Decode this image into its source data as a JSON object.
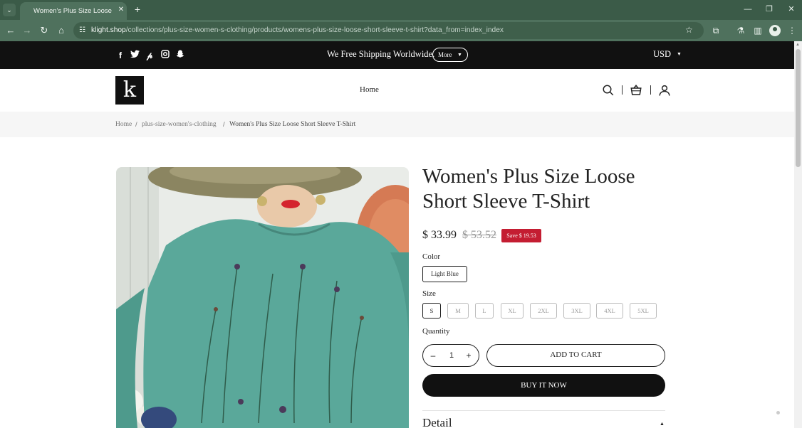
{
  "browser": {
    "tab_title": "Women's Plus Size Loose Short",
    "url_host": "klight.shop",
    "url_path": "/collections/plus-size-women-s-clothing/products/womens-plus-size-loose-short-sleeve-t-shirt?data_from=index_index",
    "icons": [
      "tab-list-icon",
      "close-icon",
      "plus-icon",
      "minimize-icon",
      "restore-icon",
      "window-close-icon",
      "back-icon",
      "forward-icon",
      "reload-icon",
      "home-icon",
      "site-info-icon",
      "bookmark-star-icon",
      "extensions-icon",
      "labs-icon",
      "side-panel-icon",
      "profile-icon",
      "menu-icon"
    ]
  },
  "announcement": {
    "text": "We Free Shipping Worldwide.",
    "more_label": "More",
    "currency": "USD",
    "social_icons": [
      "facebook-icon",
      "twitter-icon",
      "pinterest-icon",
      "instagram-icon",
      "snapchat-icon"
    ]
  },
  "header": {
    "logo_letter": "k",
    "nav_home": "Home",
    "icons": [
      "search-icon",
      "cart-icon",
      "account-icon"
    ]
  },
  "breadcrumb": {
    "home": "Home",
    "collection": "plus-size-women's-clothing",
    "current": "Women's Plus Size Loose Short Sleeve T-Shirt",
    "separator": "/"
  },
  "product": {
    "title": "Women's Plus Size Loose Short Sleeve T-Shirt",
    "price": "$ 33.99",
    "compare_price": "$ 53.52",
    "save_badge": "Save $ 19.53",
    "color_label": "Color",
    "color_selected": "Light Blue",
    "size_label": "Size",
    "sizes": [
      "S",
      "M",
      "L",
      "XL",
      "2XL",
      "3XL",
      "4XL",
      "5XL"
    ],
    "size_selected": "S",
    "quantity_label": "Quantity",
    "quantity_value": "1",
    "minus": "–",
    "plus": "+",
    "add_to_cart": "ADD TO CART",
    "buy_now": "BUY IT NOW",
    "detail_title": "Detail",
    "image_colors": {
      "shirt": "#5aa89a",
      "background": "#e9ece8"
    }
  }
}
